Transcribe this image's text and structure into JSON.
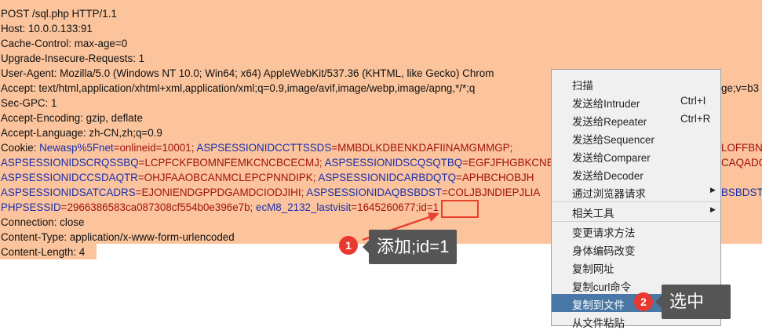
{
  "request": {
    "request_line": "POST /sql.php HTTP/1.1",
    "host": "Host: 10.0.0.133:91",
    "cache_control": "Cache-Control: max-age=0",
    "upgrade": "Upgrade-Insecure-Requests: 1",
    "user_agent": "User-Agent: Mozilla/5.0 (Windows NT 10.0; Win64; x64) AppleWebKit/537.36 (KHTML, like Gecko) Chrom",
    "accept": "Accept: text/html,application/xhtml+xml,application/xml;q=0.9,image/avif,image/webp,image/apng,*/*;q",
    "accept_tail": "ge;v=b3",
    "sec_gpc": "Sec-GPC: 1",
    "accept_encoding": "Accept-Encoding: gzip, deflate",
    "accept_language": "Accept-Language: zh-CN,zh;q=0.9",
    "cookie_label": "Cookie: ",
    "c1k": "Newasp%5Fnet",
    "c1v": "=onlineid=10001; ",
    "c2k": "ASPSESSIONIDCCTTSSDS",
    "c2v": "=MMBDLKDBENKDAFIINAMGMMGP;",
    "c2tail": "LOFFBNC",
    "c3k": "ASPSESSIONIDSCRQSSBQ",
    "c3v": "=LCPFCKFBOMNFEMKCNCBCECMJ; ",
    "c4k": "ASPSESSIONIDSCQSQTBQ",
    "c4v": "=EGFJFHGBKCNE",
    "c4tail": "CAQADC",
    "c5k": "ASPSESSIONIDCCSDAQTR",
    "c5v": "=OHJFAAOBCANMCLEPCPNNDIPK; ",
    "c6k": "ASPSESSIONIDCARBDQTQ",
    "c6v": "=APHBCHOBJH",
    "c7k": "ASPSESSIONIDSATCADRS",
    "c7v": "=EJONIENDGPPDGAMDCIODJIHI; ",
    "c8k": "ASPSESSIONIDAQBSBDST",
    "c8v": "=COLJBJNDIEPJLIA",
    "c8tail": "BSBDST",
    "c9k": "PHPSESSID",
    "c9v": "=2966386583ca087308cf554b0e396e7b; ",
    "c10k": "ecM8_2132_lastvisit",
    "c10v": "=1645260677",
    "added": ";id=1",
    "connection": "Connection: close",
    "content_type": "Content-Type: application/x-www-form-urlencoded",
    "content_length": "Content-Length: 4"
  },
  "annotations": {
    "step1_number": "1",
    "step1_text": "添加;id=1",
    "step2_number": "2",
    "step2_text": "选中"
  },
  "menu": {
    "scan": "扫描",
    "intruder": "发送给Intruder",
    "intruder_shortcut": "Ctrl+I",
    "repeater": "发送给Repeater",
    "repeater_shortcut": "Ctrl+R",
    "sequencer": "发送给Sequencer",
    "comparer": "发送给Comparer",
    "decoder": "发送给Decoder",
    "browser": "通过浏览器请求",
    "tools": "相关工具",
    "change_method": "变更请求方法",
    "change_encoding": "身体编码改变",
    "copy_url": "复制网址",
    "copy_curl": "复制curl命令",
    "copy_to_file": "复制到文件",
    "paste_from_file": "从文件粘贴"
  },
  "colors": {
    "request_bg": "#fbc49c",
    "cookie_name": "#1a2fb0",
    "cookie_value": "#a01212",
    "highlight": "#e8412f",
    "menu_selected": "#4a78a6"
  }
}
